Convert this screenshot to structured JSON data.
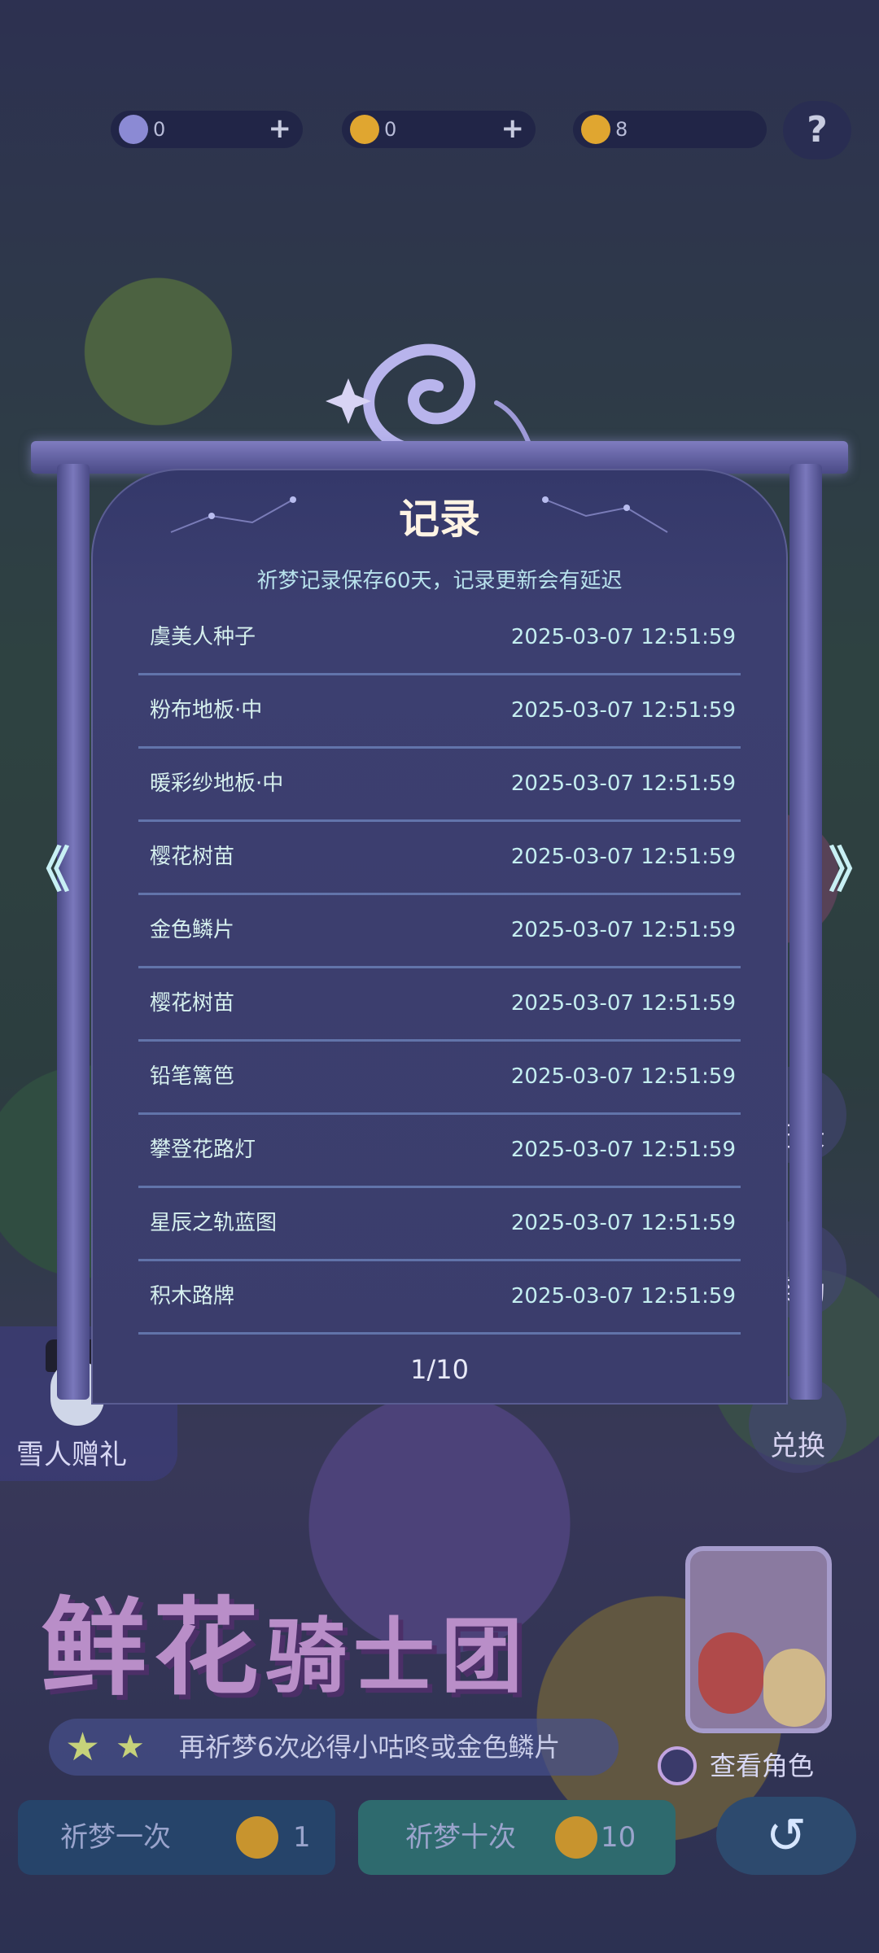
{
  "currencies": [
    {
      "name": "moon",
      "value": "0",
      "color": "#8b8ad4",
      "plus": "+"
    },
    {
      "name": "coin",
      "value": "0",
      "color": "#e0a630",
      "plus": "+"
    },
    {
      "name": "ticket",
      "value": "8",
      "color": "#e0a630"
    }
  ],
  "help_label": "?",
  "side_buttons": {
    "records": "记录",
    "rewards": "奖励",
    "exchange": "兑换"
  },
  "snowman_gift": "雪人赠礼",
  "banner": {
    "title_big": "鲜花",
    "title_small": "骑士团",
    "pity_text": "再祈梦6次必得小咕咚或金色鳞片",
    "view_role": "查看角色"
  },
  "bottom_buttons": {
    "single": {
      "label": "祈梦一次",
      "cost": "1"
    },
    "ten": {
      "label": "祈梦十次",
      "cost": "10"
    },
    "back_icon": "↺"
  },
  "modal": {
    "title": "记录",
    "subtitle": "祈梦记录保存60天，记录更新会有延迟",
    "rows": [
      {
        "name": "虞美人种子",
        "time": "2025-03-07 12:51:59"
      },
      {
        "name": "粉布地板·中",
        "time": "2025-03-07 12:51:59"
      },
      {
        "name": "暖彩纱地板·中",
        "time": "2025-03-07 12:51:59"
      },
      {
        "name": "樱花树苗",
        "time": "2025-03-07 12:51:59"
      },
      {
        "name": "金色鳞片",
        "time": "2025-03-07 12:51:59"
      },
      {
        "name": "樱花树苗",
        "time": "2025-03-07 12:51:59"
      },
      {
        "name": "铅笔篱笆",
        "time": "2025-03-07 12:51:59"
      },
      {
        "name": "攀登花路灯",
        "time": "2025-03-07 12:51:59"
      },
      {
        "name": "星辰之轨蓝图",
        "time": "2025-03-07 12:51:59"
      },
      {
        "name": "积木路牌",
        "time": "2025-03-07 12:51:59"
      }
    ],
    "pager": "1/10",
    "prev_icon": "《",
    "next_icon": "》"
  }
}
